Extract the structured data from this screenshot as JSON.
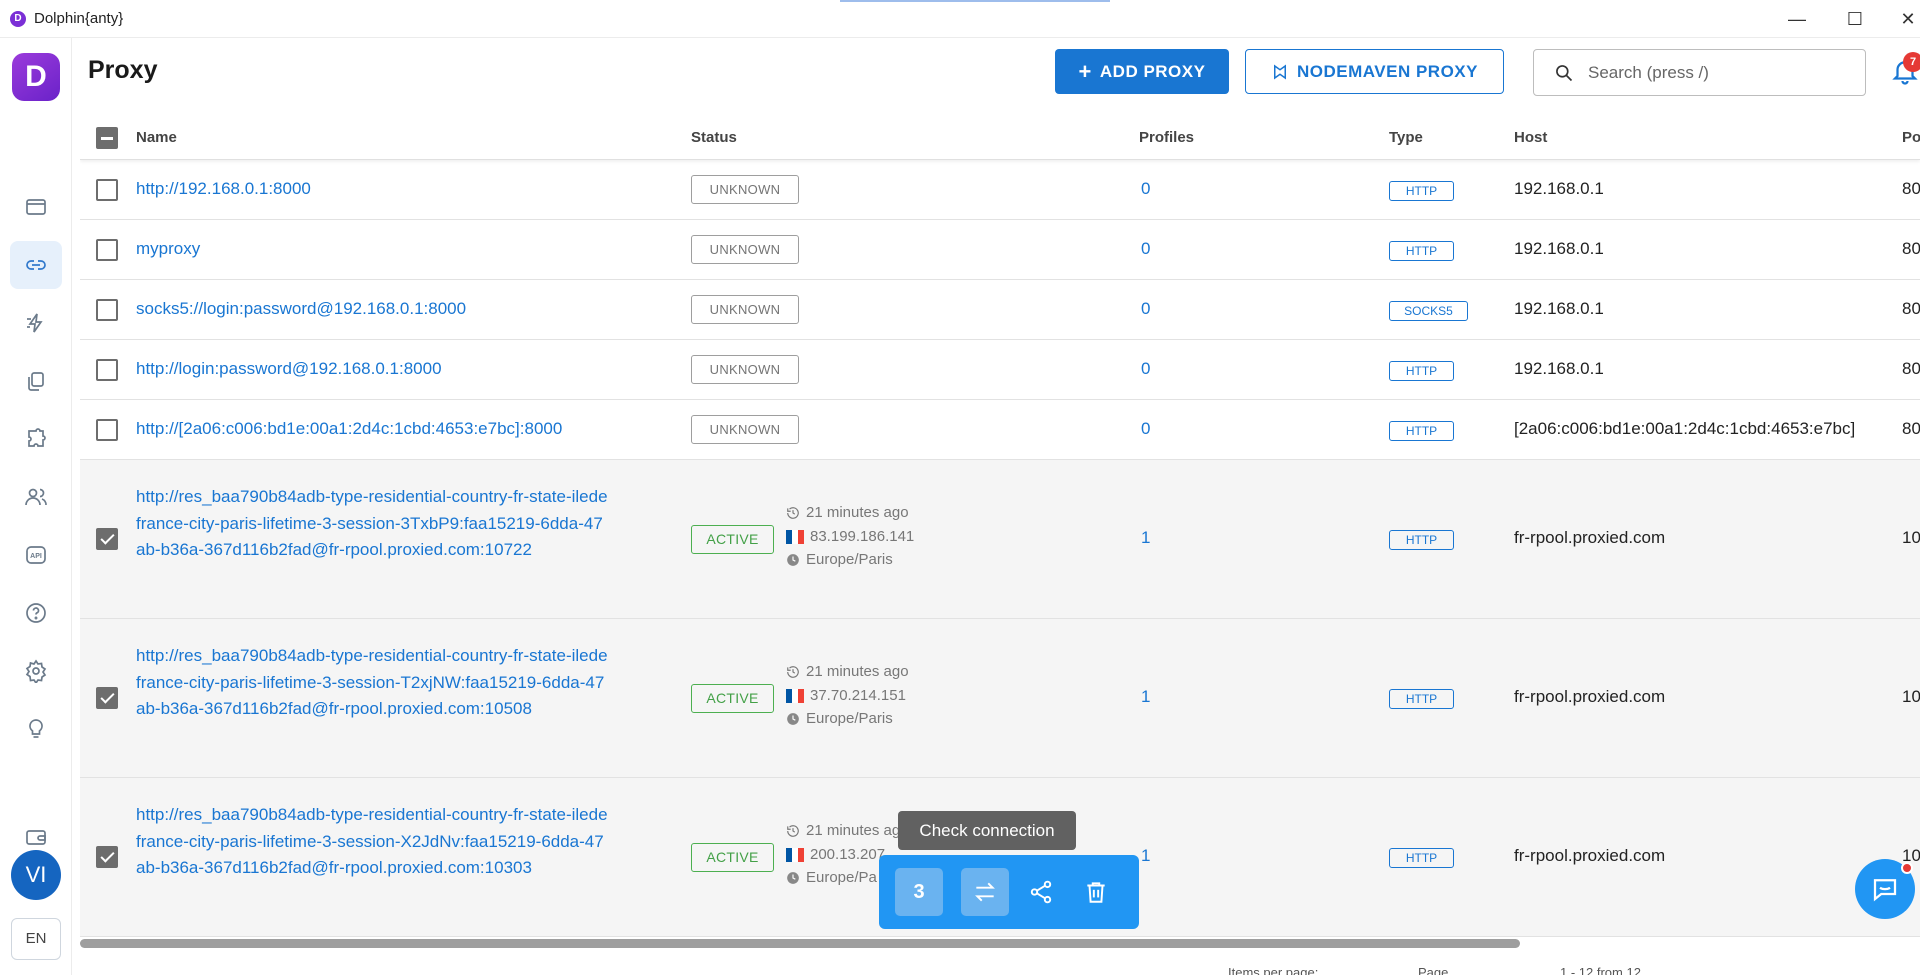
{
  "window": {
    "title": "Dolphin{anty}",
    "logo_letter": "D"
  },
  "sidebar": {
    "logo_letter": "D",
    "items": [
      {
        "name": "browser-profiles",
        "icon": "window-icon"
      },
      {
        "name": "proxy",
        "icon": "link-icon",
        "active": true
      },
      {
        "name": "automation",
        "icon": "lightning-icon"
      },
      {
        "name": "extensions-copy",
        "icon": "copy-icon"
      },
      {
        "name": "extensions",
        "icon": "puzzle-icon"
      },
      {
        "name": "team",
        "icon": "users-icon"
      },
      {
        "name": "api",
        "icon": "api-icon",
        "label": "API"
      },
      {
        "name": "help",
        "icon": "question-icon"
      },
      {
        "name": "settings",
        "icon": "gear-icon"
      },
      {
        "name": "ideas",
        "icon": "lightbulb-icon"
      },
      {
        "name": "wallet",
        "icon": "wallet-icon"
      }
    ],
    "avatar_initials": "VI",
    "language": "EN"
  },
  "header": {
    "page_title": "Proxy",
    "add_proxy_label": "ADD PROXY",
    "nodemaven_label": "NODEMAVEN PROXY",
    "search_placeholder": "Search (press /)",
    "notification_count": "7"
  },
  "table": {
    "columns": [
      "Name",
      "Status",
      "Profiles",
      "Type",
      "Host",
      "Po"
    ],
    "rows": [
      {
        "name": "http://192.168.0.1:8000",
        "status": "UNKNOWN",
        "profiles": "0",
        "type": "HTTP",
        "host": "192.168.0.1",
        "port": "80",
        "checked": false
      },
      {
        "name": "myproxy",
        "status": "UNKNOWN",
        "profiles": "0",
        "type": "HTTP",
        "host": "192.168.0.1",
        "port": "80",
        "checked": false
      },
      {
        "name": "socks5://login:password@192.168.0.1:8000",
        "status": "UNKNOWN",
        "profiles": "0",
        "type": "SOCKS5",
        "host": "192.168.0.1",
        "port": "80",
        "checked": false
      },
      {
        "name": "http://login:password@192.168.0.1:8000",
        "status": "UNKNOWN",
        "profiles": "0",
        "type": "HTTP",
        "host": "192.168.0.1",
        "port": "80",
        "checked": false
      },
      {
        "name": "http://[2a06:c006:bd1e:00a1:2d4c:1cbd:4653:e7bc]:8000",
        "status": "UNKNOWN",
        "profiles": "0",
        "type": "HTTP",
        "host": "[2a06:c006:bd1e:00a1:2d4c:1cbd:4653:e7bc]",
        "port": "80",
        "checked": false
      },
      {
        "name": "http://res_baa790b84adb-type-residential-country-fr-state-iledefrance-city-paris-lifetime-3-session-3TxbP9:faa15219-6dda-47ab-b36a-367d116b2fad@fr-rpool.proxied.com:10722",
        "status": "ACTIVE",
        "checked_ago": "21 minutes ago",
        "ip": "83.199.186.141",
        "timezone": "Europe/Paris",
        "profiles": "1",
        "type": "HTTP",
        "host": "fr-rpool.proxied.com",
        "port": "10",
        "checked": true
      },
      {
        "name": "http://res_baa790b84adb-type-residential-country-fr-state-iledefrance-city-paris-lifetime-3-session-T2xjNW:faa15219-6dda-47ab-b36a-367d116b2fad@fr-rpool.proxied.com:10508",
        "status": "ACTIVE",
        "checked_ago": "21 minutes ago",
        "ip": "37.70.214.151",
        "timezone": "Europe/Paris",
        "profiles": "1",
        "type": "HTTP",
        "host": "fr-rpool.proxied.com",
        "port": "10",
        "checked": true
      },
      {
        "name": "http://res_baa790b84adb-type-residential-country-fr-state-iledefrance-city-paris-lifetime-3-session-X2JdNv:faa15219-6dda-47ab-b36a-367d116b2fad@fr-rpool.proxied.com:10303",
        "status": "ACTIVE",
        "checked_ago": "21 minutes ago",
        "ip": "200.13.207",
        "timezone": "Europe/Pa",
        "profiles": "1",
        "type": "HTTP",
        "host": "fr-rpool.proxied.com",
        "port": "10",
        "checked": true
      }
    ]
  },
  "action_bar": {
    "selected_count": "3",
    "tooltip": "Check connection"
  },
  "footer": {
    "items_per_page": "Items per page:",
    "page": "Page",
    "range": "1 - 12 from 12"
  },
  "colors": {
    "accent": "#1976d2",
    "active_green": "#43a047",
    "brand_purple": "#7b2fd6"
  }
}
